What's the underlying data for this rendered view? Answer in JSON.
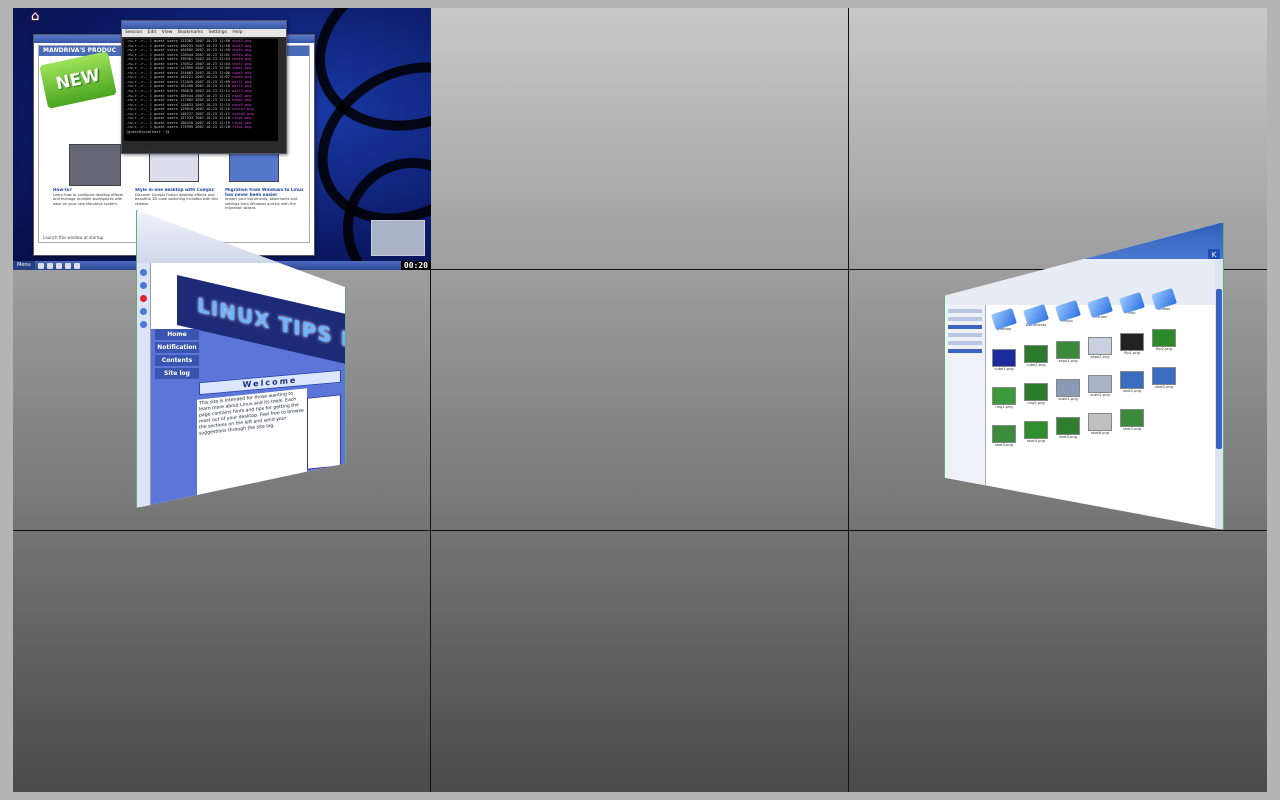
{
  "desktop_pager": {
    "columns": 3,
    "rows": 3,
    "desktops": [
      {
        "index": 1
      },
      {
        "index": 2
      },
      {
        "index": 3
      },
      {
        "index": 4
      },
      {
        "index": 5
      },
      {
        "index": 6
      },
      {
        "index": 7
      },
      {
        "index": 8
      },
      {
        "index": 9
      }
    ]
  },
  "desktop1": {
    "home_icon": "home-icon",
    "browser_window": {
      "header": "MANDRIVA'S PRODUC",
      "badge": "NEW",
      "columns": [
        {
          "heading": "How-To?",
          "body": "Learn how to configure desktop effects and manage multiple workspaces with ease on your new Mandriva system."
        },
        {
          "heading": "Style in one desktop with Compiz",
          "body": "Discover Compiz Fusion desktop effects and beautiful 3D cube switching included with this release."
        },
        {
          "heading": "Migration from Windows to Linux has never been easier",
          "body": "Import your documents, bookmarks and settings from Windows quickly with the migration wizard."
        }
      ],
      "footer": "Launch this window at startup"
    },
    "terminal_window": {
      "menu": [
        "Session",
        "Edit",
        "View",
        "Bookmarks",
        "Settings",
        "Help"
      ],
      "tabs": [
        "Shell",
        "Shell No. 2"
      ],
      "lines": [
        "-rw-r--r-- 1 guest users 133302 2007-10-23 11:58 shot2.png",
        "-rw-r--r-- 1 guest users 180233 2007-10-23 11:58 shot3.png",
        "-rw-r--r-- 1 guest users 164902 2007-10-23 11:59 shot4.png",
        "-rw-r--r-- 1 guest users 120444 2007-10-23 12:01 shot5.png",
        "-rw-r--r-- 1 guest users 199301 2007-10-23 12:03 shot6.png",
        "-rw-r--r-- 1 guest users 176512 2007-10-23 12:04 shot7.png",
        "-rw-r--r-- 1 guest users 143999 2007-10-23 12:05 cube1.png",
        "-rw-r--r-- 1 guest users 154003 2007-10-23 12:06 cube2.png",
        "-rw-r--r-- 1 guest users 163221 2007-10-23 12:07 cube3.png",
        "-rw-r--r-- 1 guest users 172845 2007-10-23 12:09 wall1.png",
        "-rw-r--r-- 1 guest users 181200 2007-10-23 12:10 wall2.png",
        "-rw-r--r-- 1 guest users 190876 2007-10-23 12:12 wall3.png",
        "-rw-r--r-- 1 guest users 105544 2007-10-23 12:13 expo1.png",
        "-rw-r--r-- 1 guest users 117002 2007-10-23 12:14 expo2.png",
        "-rw-r--r-- 1 guest users 128833 2007-10-23 12:15 expo3.png",
        "-rw-r--r-- 1 guest users 139010 2007-10-23 12:16 scale1.png",
        "-rw-r--r-- 1 guest users 148227 2007-10-23 12:17 scale2.png",
        "-rw-r--r-- 1 guest users 157333 2007-10-23 12:18 ring1.png",
        "-rw-r--r-- 1 guest users 166410 2007-10-23 12:19 ring2.png",
        "-rw-r--r-- 1 guest users 175999 2007-10-23 12:20 flip1.png",
        "[guest@localhost ~]$"
      ]
    },
    "taskbar": {
      "start_label": "Menu",
      "clock": "00:20"
    }
  },
  "linux_tips_window": {
    "banner": "LINUX TIPS FOR FREE",
    "nav": [
      "Home",
      "Notification",
      "Contents",
      "Site log"
    ],
    "welcome": "Welcome",
    "body": "This site is intended for those wanting to learn more about Linux and its tools. Each page contains hints and tips for getting the most out of your desktop. Feel free to browse the sections on the left and send your suggestions through the site log."
  },
  "file_manager_window": {
    "kde_button": "K",
    "files": [
      {
        "name": "Desktop",
        "kind": "folder"
      },
      {
        "name": "Documents",
        "kind": "folder"
      },
      {
        "name": "Music",
        "kind": "folder"
      },
      {
        "name": "Pictures",
        "kind": "folder"
      },
      {
        "name": "tmp",
        "kind": "folder"
      },
      {
        "name": "Videos",
        "kind": "folder"
      },
      {
        "name": "cube1.png",
        "kind": "image",
        "color": "#1d2a9c"
      },
      {
        "name": "cube2.png",
        "kind": "image",
        "color": "#2b7a2b"
      },
      {
        "name": "expo1.png",
        "kind": "image",
        "color": "#3a8a3a"
      },
      {
        "name": "expo2.png",
        "kind": "image",
        "color": "#c8d0e0"
      },
      {
        "name": "flip1.png",
        "kind": "image",
        "color": "#222222"
      },
      {
        "name": "flip2.png",
        "kind": "image",
        "color": "#2a8a2a"
      },
      {
        "name": "ring1.png",
        "kind": "image",
        "color": "#3c9a3c"
      },
      {
        "name": "ring2.png",
        "kind": "image",
        "color": "#2a7a2a"
      },
      {
        "name": "scale1.png",
        "kind": "image",
        "color": "#889ab8"
      },
      {
        "name": "scale2.png",
        "kind": "image",
        "color": "#aab4c8"
      },
      {
        "name": "shot1.png",
        "kind": "image",
        "color": "#3a6cc0"
      },
      {
        "name": "shot2.png",
        "kind": "image",
        "color": "#3a6cc0"
      },
      {
        "name": "shot3.png",
        "kind": "image",
        "color": "#3c8c3c"
      },
      {
        "name": "shot4.png",
        "kind": "image",
        "color": "#2f8f2f"
      },
      {
        "name": "shot5.png",
        "kind": "image",
        "color": "#2f7f2f"
      },
      {
        "name": "shot6.png",
        "kind": "image",
        "color": "#c0c0c0"
      },
      {
        "name": "shot7.png",
        "kind": "image",
        "color": "#3a8a3a"
      }
    ]
  }
}
